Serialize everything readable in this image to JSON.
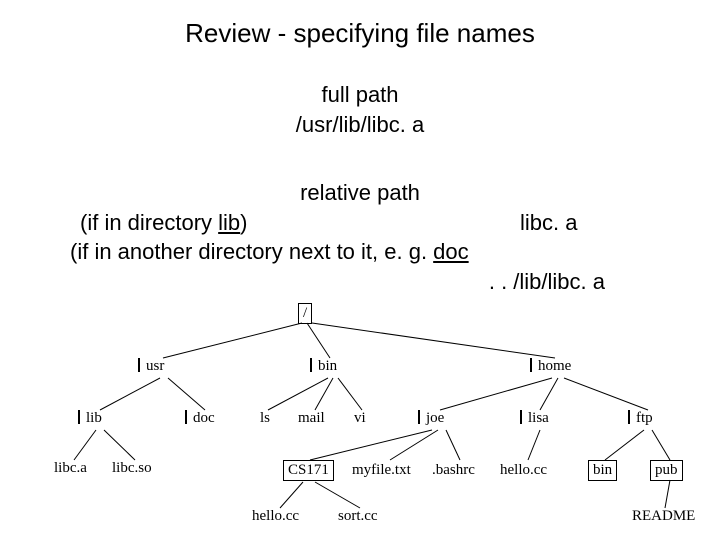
{
  "title": "Review - specifying file names",
  "fullpath": {
    "heading": "full path",
    "value": "/usr/lib/libc. a"
  },
  "relpath": {
    "heading": "relative path",
    "line_if_lib_prefix": "(if in directory ",
    "line_if_lib_dir": "lib",
    "line_if_lib_suffix": ")",
    "line_if_lib_value": "libc. a",
    "line_if_doc_prefix": "(if in another directory next to it, e. g. ",
    "line_if_doc_dir": "doc",
    "line_if_doc_value": ". . /lib/libc. a"
  },
  "tree": {
    "root": "/",
    "usr": "usr",
    "bin": "bin",
    "home": "home",
    "lib": "lib",
    "doc": "doc",
    "ls": "ls",
    "mail": "mail",
    "vi": "vi",
    "joe": "joe",
    "lisa": "lisa",
    "ftp": "ftp",
    "libc_a": "libc.a",
    "libc_so": "libc.so",
    "cs171": "CS171",
    "myfile": "myfile.txt",
    "bashrc": ".bashrc",
    "hello_cc": "hello.cc",
    "bin2": "bin",
    "pub": "pub",
    "hello_cc2": "hello.cc",
    "sort_cc": "sort.cc",
    "readme": "README"
  }
}
